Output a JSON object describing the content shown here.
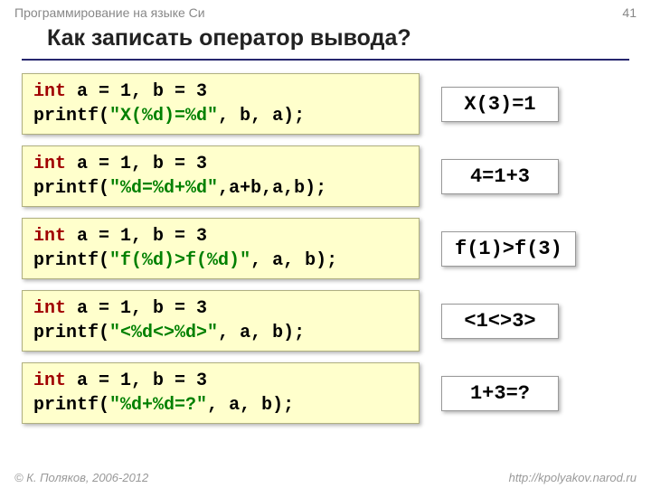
{
  "header": {
    "course": "Программирование на языке Си",
    "page_number": "41"
  },
  "title": "Как записать оператор вывода?",
  "examples": [
    {
      "decl_pre": "int",
      "decl_rest": " a = 1, b = 3",
      "printf_head": "printf(",
      "fmt_open": "\"",
      "fmt_core": "X(%d)=%d",
      "fmt_close": "\"",
      "args_tail": ", b, a);",
      "output": "X(3)=1"
    },
    {
      "decl_pre": "int",
      "decl_rest": " a = 1, b = 3",
      "printf_head": "printf(",
      "fmt_open": "\"",
      "fmt_core": "%d=%d+%d",
      "fmt_close": "\"",
      "args_tail": ",a+b,a,b);",
      "output": "4=1+3"
    },
    {
      "decl_pre": "int",
      "decl_rest": " a = 1, b = 3",
      "printf_head": "printf(",
      "fmt_open": "\"",
      "fmt_core": "f(%d)>f(%d)",
      "fmt_close": "\"",
      "args_tail": ", a, b);",
      "output": "f(1)>f(3)"
    },
    {
      "decl_pre": "int",
      "decl_rest": " a = 1, b = 3",
      "printf_head": "printf(",
      "fmt_open": "\"",
      "fmt_core": "<%d<>%d>",
      "fmt_close": "\"",
      "args_tail": ", a, b);",
      "output": "<1<>3>"
    },
    {
      "decl_pre": "int",
      "decl_rest": " a = 1, b = 3",
      "printf_head": "printf(",
      "fmt_open": "\"",
      "fmt_core": "%d+%d=?",
      "fmt_close": "\"",
      "args_tail": ", a, b);",
      "output": "1+3=?"
    }
  ],
  "footer": {
    "copyright": "© К. Поляков, 2006-2012",
    "url": "http://kpolyakov.narod.ru"
  }
}
